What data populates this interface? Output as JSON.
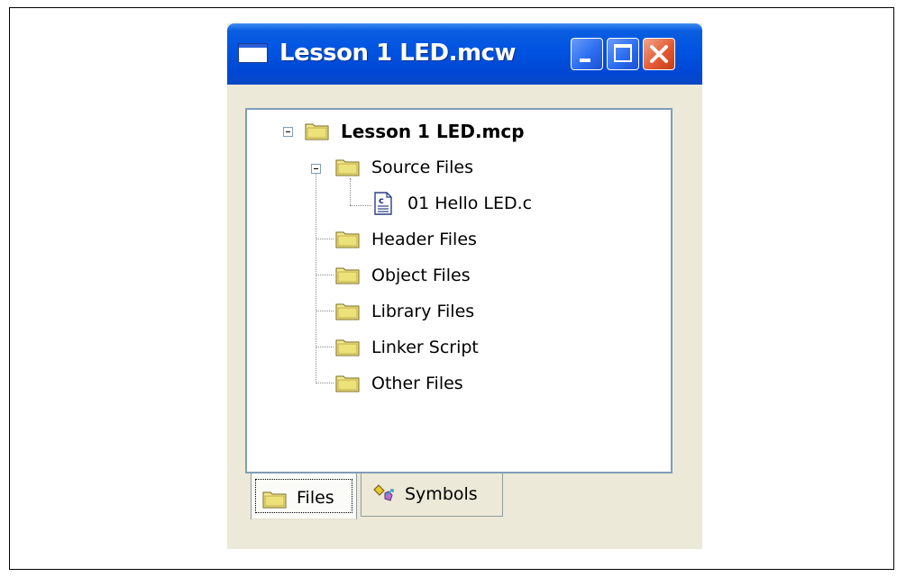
{
  "window": {
    "title": "Lesson 1 LED.mcw"
  },
  "tree": {
    "root": {
      "label": "Lesson 1 LED.mcp",
      "icon": "folder-icon",
      "expanded": true
    },
    "source_files": {
      "label": "Source Files",
      "icon": "folder-icon",
      "expanded": true
    },
    "source_file_item": {
      "label": "01 Hello LED.c",
      "icon": "c-file-icon"
    },
    "folders": [
      {
        "label": "Header Files",
        "icon": "folder-icon"
      },
      {
        "label": "Object Files",
        "icon": "folder-icon"
      },
      {
        "label": "Library Files",
        "icon": "folder-icon"
      },
      {
        "label": "Linker Script",
        "icon": "folder-icon"
      },
      {
        "label": "Other Files",
        "icon": "folder-icon"
      }
    ]
  },
  "tabs": [
    {
      "label": "Files",
      "icon": "folder-icon",
      "active": true
    },
    {
      "label": "Symbols",
      "icon": "symbols-icon",
      "active": false
    }
  ],
  "colors": {
    "titlebar": "#0053e1",
    "window_bg": "#ece9d8",
    "close_button": "#e45b34",
    "folder_fill": "#ece27a"
  }
}
